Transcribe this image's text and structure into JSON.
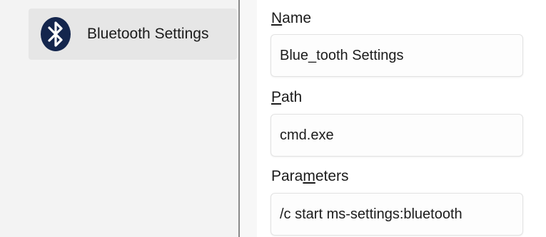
{
  "list": {
    "items": [
      {
        "label": "Bluetooth Settings",
        "icon": "bluetooth-icon",
        "selected": true
      }
    ]
  },
  "form": {
    "name": {
      "label": "Name",
      "value": "Blue_tooth Settings"
    },
    "path": {
      "label": "Path",
      "value": "cmd.exe"
    },
    "parameters": {
      "label": "Parameters",
      "value": "/c start ms-settings:bluetooth"
    }
  },
  "colors": {
    "bluetooth_icon_bg": "#14264d",
    "selected_item_bg": "#e6e6e6",
    "splitter": "#8a8a8a"
  }
}
